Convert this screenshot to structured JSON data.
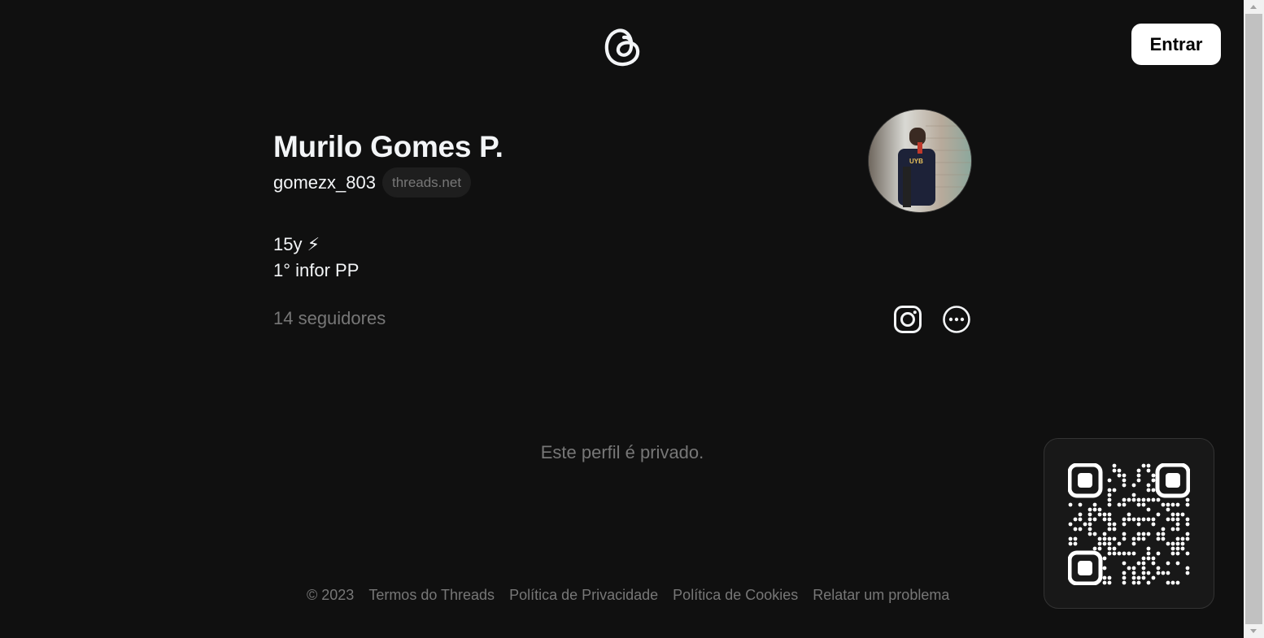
{
  "header": {
    "logo_icon": "threads-logo-icon",
    "login_label": "Entrar"
  },
  "profile": {
    "name": "Murilo Gomes P.",
    "handle": "gomezx_803",
    "domain": "threads.net",
    "avatar_icon": "profile-photo",
    "bio": [
      "15y ⚡",
      "1° infor PP"
    ],
    "followers": "14 seguidores",
    "action_icons": [
      "instagram-icon",
      "more-options-icon"
    ]
  },
  "content": {
    "private_message": "Este perfil é privado."
  },
  "footer": {
    "links": [
      "© 2023",
      "Termos do Threads",
      "Política de Privacidade",
      "Política de Cookies",
      "Relatar um problema"
    ]
  },
  "qr": {
    "icon": "qr-code-icon"
  },
  "colors": {
    "background": "#101010",
    "text": "#f3f5f7",
    "muted": "#777777",
    "button_bg": "#ffffff"
  }
}
